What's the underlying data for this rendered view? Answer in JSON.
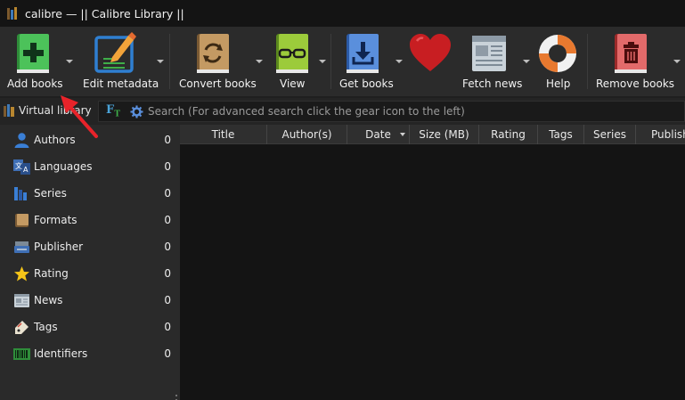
{
  "window": {
    "title": "calibre — || Calibre Library ||"
  },
  "toolbar": {
    "add_books": "Add books",
    "edit_metadata": "Edit metadata",
    "convert_books": "Convert books",
    "view": "View",
    "get_books": "Get books",
    "fetch_news": "Fetch news",
    "help": "Help",
    "remove_books": "Remove books"
  },
  "search": {
    "virtual_library": "Virtual library",
    "placeholder": "Search (For advanced search click the gear icon to the left)"
  },
  "sidebar": {
    "items": [
      {
        "label": "Authors",
        "count": "0",
        "icon": "authors-icon"
      },
      {
        "label": "Languages",
        "count": "0",
        "icon": "languages-icon"
      },
      {
        "label": "Series",
        "count": "0",
        "icon": "series-icon"
      },
      {
        "label": "Formats",
        "count": "0",
        "icon": "formats-icon"
      },
      {
        "label": "Publisher",
        "count": "0",
        "icon": "publisher-icon"
      },
      {
        "label": "Rating",
        "count": "0",
        "icon": "rating-icon"
      },
      {
        "label": "News",
        "count": "0",
        "icon": "news-icon"
      },
      {
        "label": "Tags",
        "count": "0",
        "icon": "tags-icon"
      },
      {
        "label": "Identifiers",
        "count": "0",
        "icon": "identifiers-icon"
      }
    ]
  },
  "table": {
    "columns": [
      "Title",
      "Author(s)",
      "Date",
      "Size (MB)",
      "Rating",
      "Tags",
      "Series",
      "Published"
    ]
  },
  "colors": {
    "annotation_arrow": "#e8232a",
    "add_books_green": "#3fae49",
    "edit_metadata_blue": "#2f7fd1"
  }
}
